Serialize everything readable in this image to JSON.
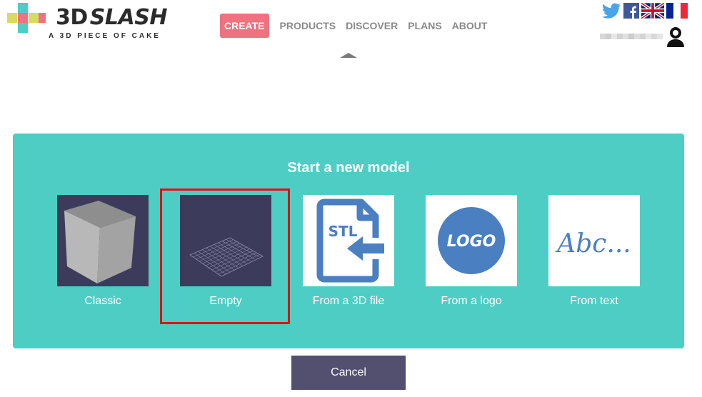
{
  "brand": {
    "word_bold": "3D",
    "word_italic": "SLASH",
    "tagline": "A 3D PIECE OF CAKE",
    "colors": {
      "pink": "#f0717f",
      "yellow": "#d8dc5a",
      "teal": "#4ecdc4"
    }
  },
  "nav": {
    "items": [
      {
        "label": "CREATE",
        "active": true
      },
      {
        "label": "PRODUCTS"
      },
      {
        "label": "DISCOVER"
      },
      {
        "label": "PLANS"
      },
      {
        "label": "ABOUT"
      }
    ]
  },
  "social": {
    "icons": [
      "twitter-icon",
      "facebook-icon",
      "uk-flag-icon",
      "france-flag-icon"
    ]
  },
  "panel": {
    "title": "Start a new model",
    "background": "#4ecdc4",
    "options": [
      {
        "label": "Classic",
        "icon": "cube-icon"
      },
      {
        "label": "Empty",
        "icon": "grid-plane-icon",
        "highlighted": true
      },
      {
        "label": "From a 3D file",
        "icon": "stl-file-icon",
        "file_text": "STL"
      },
      {
        "label": "From a logo",
        "icon": "logo-badge-icon",
        "logo_text": "LOGO"
      },
      {
        "label": "From text",
        "icon": "script-text-icon",
        "script_text": "Abc..."
      }
    ]
  },
  "cancel": {
    "label": "Cancel",
    "color": "#524f6f"
  }
}
